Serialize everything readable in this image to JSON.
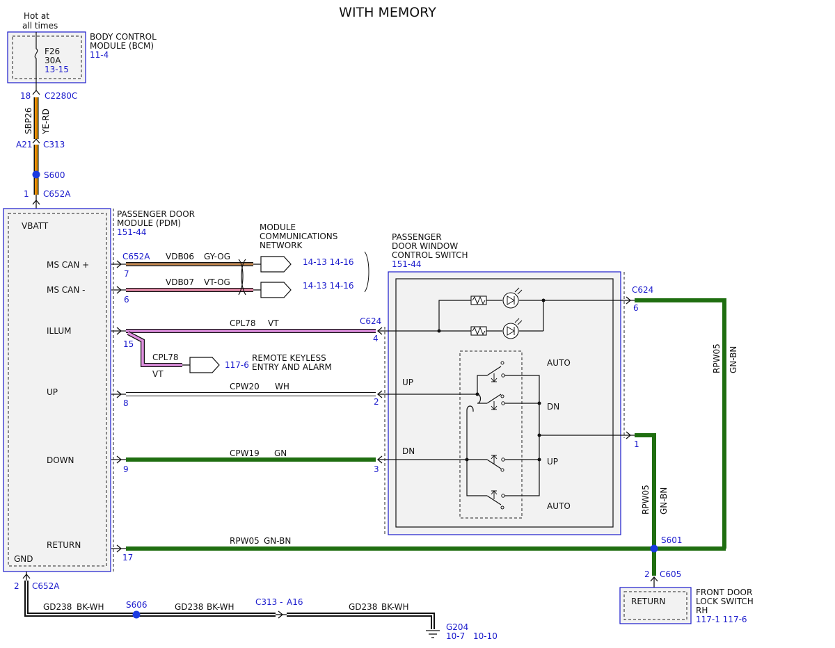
{
  "title": "WITH MEMORY",
  "colors": {
    "yellow_red": "#f2b400",
    "gray_orange": "#a0826a",
    "violet_orange": "#e58aa8",
    "violet": "#e090e0",
    "white": "#ffffff",
    "green": "#1f6e10",
    "black_white": "#111111",
    "box_blue": "#1a1acc",
    "splice": "#1a3ae0"
  },
  "bcm": {
    "hot_label_1": "Hot at",
    "hot_label_2": "all times",
    "name_1": "BODY CONTROL",
    "name_2": "MODULE (BCM)",
    "ref": "11-4",
    "fuse_id": "F26",
    "fuse_rating": "30A",
    "fuse_ref": "13-15"
  },
  "top_feed": {
    "pin_bcm": "18",
    "conn_bcm": "C2280C",
    "circuit": "SBP26",
    "color": "YE-RD",
    "pin_inline": "A21",
    "conn_inline": "C313",
    "splice": "S600",
    "pin_pdm": "1",
    "conn_pdm": "C652A"
  },
  "pdm": {
    "name_1": "PASSENGER DOOR",
    "name_2": "MODULE (PDM)",
    "ref": "151-44",
    "vbatt": "VBATT",
    "ms_can_plus": "MS CAN +",
    "ms_can_minus": "MS CAN -",
    "illum": "ILLUM",
    "up": "UP",
    "down": "DOWN",
    "return": "RETURN",
    "gnd": "GND"
  },
  "network": {
    "label_1": "MODULE",
    "label_2": "COMMUNICATIONS",
    "label_3": "NETWORK",
    "conn": "C652A",
    "ref_plus": "14-13 14-16",
    "ref_minus": "14-13 14-16",
    "pin_plus": "7",
    "pin_minus": "6",
    "circuit_plus": "VDB06",
    "color_plus": "GY-OG",
    "circuit_minus": "VDB07",
    "color_minus": "VT-OG"
  },
  "wires": {
    "illum_pin": "15",
    "illum_circuit": "CPL78",
    "illum_color": "VT",
    "illum_switch_conn": "C624",
    "illum_switch_pin": "4",
    "rke_circuit": "CPL78",
    "rke_color": "VT",
    "rke_ref": "117-6",
    "rke_label_1": "REMOTE KEYLESS",
    "rke_label_2": "ENTRY AND ALARM",
    "up_pin": "8",
    "up_circuit": "CPW20",
    "up_color": "WH",
    "up_switch_pin": "2",
    "down_pin": "9",
    "down_circuit": "CPW19",
    "down_color": "GN",
    "down_switch_pin": "3",
    "return_pin": "17",
    "return_circuit": "RPW05",
    "return_color": "GN-BN"
  },
  "switch": {
    "name_1": "PASSENGER",
    "name_2": "DOOR WINDOW",
    "name_3": "CONTROL SWITCH",
    "ref": "151-44",
    "up_label": "UP",
    "dn_label": "DN",
    "auto_top": "AUTO",
    "dn_right": "DN",
    "up_right": "UP",
    "auto_bottom": "AUTO",
    "conn": "C624",
    "pin_6": "6",
    "pin_1": "1"
  },
  "right_side": {
    "circuit_outer": "RPW05",
    "color_outer": "GN-BN",
    "circuit_inner": "RPW05",
    "color_inner": "GN-BN",
    "splice": "S601",
    "pin_lock": "2",
    "conn_lock": "C605",
    "lock_return": "RETURN",
    "lock_name_1": "FRONT DOOR",
    "lock_name_2": "LOCK SWITCH",
    "lock_name_3": "RH",
    "lock_ref": "117-1 117-6"
  },
  "ground": {
    "pin": "2",
    "conn": "C652A",
    "seg1_circuit": "GD238",
    "seg1_color": "BK-WH",
    "splice": "S606",
    "seg2_circuit": "GD238",
    "seg2_color": "BK-WH",
    "inline_conn": "C313 -",
    "inline_pin": "A16",
    "seg3_circuit": "GD238",
    "seg3_color": "BK-WH",
    "ground_id": "G204",
    "ground_ref_1": "10-7",
    "ground_ref_2": "10-10"
  }
}
